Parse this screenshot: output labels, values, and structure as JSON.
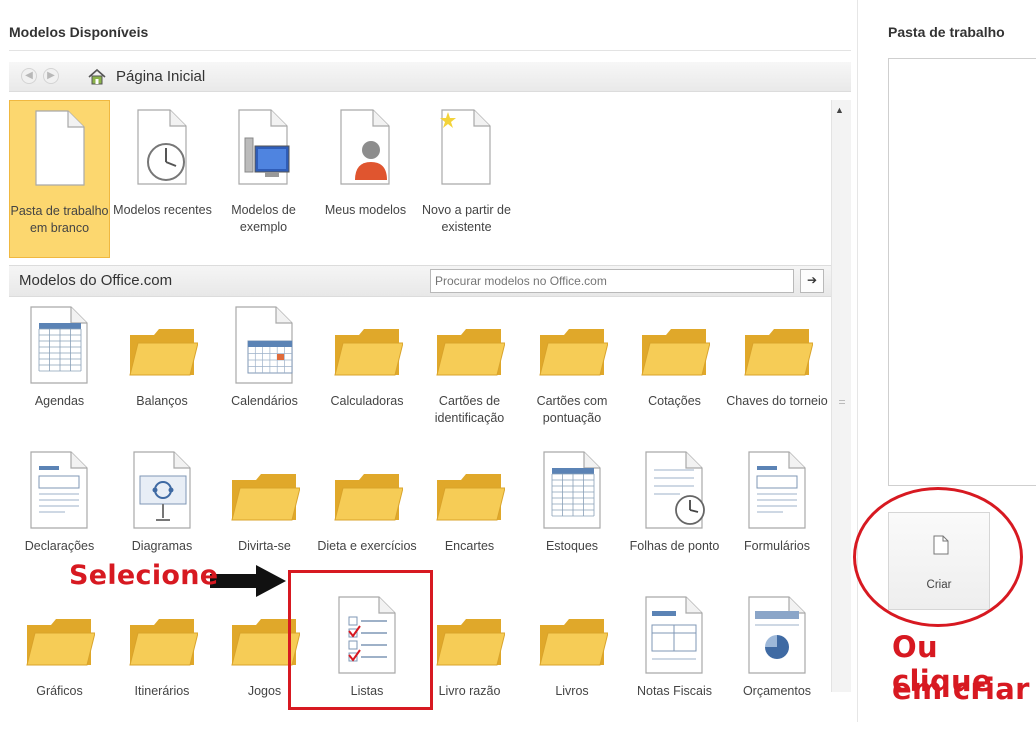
{
  "sections": {
    "available_title": "Modelos Disponíveis",
    "workbook_title": "Pasta de trabalho"
  },
  "nav": {
    "home_label": "Página Inicial"
  },
  "top_tiles": [
    {
      "label": "Pasta de trabalho em branco",
      "icon": "blank-document-icon",
      "selected": true
    },
    {
      "label": "Modelos recentes",
      "icon": "clock-document-icon"
    },
    {
      "label": "Modelos de exemplo",
      "icon": "sample-templates-icon"
    },
    {
      "label": "Meus modelos",
      "icon": "user-templates-icon"
    },
    {
      "label": "Novo a partir de existente",
      "icon": "new-from-existing-icon"
    }
  ],
  "office": {
    "label": "Modelos do Office.com",
    "search_placeholder": "Procurar modelos no Office.com",
    "search_go": "➔"
  },
  "office_rows": [
    [
      {
        "label": "Agendas",
        "icon": "spreadsheet-icon"
      },
      {
        "label": "Balanços",
        "icon": "folder-icon"
      },
      {
        "label": "Calendários",
        "icon": "calendar-icon"
      },
      {
        "label": "Calculadoras",
        "icon": "folder-icon"
      },
      {
        "label": "Cartões de identificação",
        "icon": "folder-icon"
      },
      {
        "label": "Cartões com pontuação",
        "icon": "folder-icon"
      },
      {
        "label": "Cotações",
        "icon": "folder-icon"
      },
      {
        "label": "Chaves do torneio",
        "icon": "folder-icon"
      }
    ],
    [
      {
        "label": "Declarações",
        "icon": "form-document-icon"
      },
      {
        "label": "Diagramas",
        "icon": "diagram-icon"
      },
      {
        "label": "Divirta-se",
        "icon": "folder-icon"
      },
      {
        "label": "Dieta e exercícios",
        "icon": "folder-icon"
      },
      {
        "label": "Encartes",
        "icon": "folder-icon"
      },
      {
        "label": "Estoques",
        "icon": "spreadsheet-icon"
      },
      {
        "label": "Folhas de ponto",
        "icon": "timesheet-icon"
      },
      {
        "label": "Formulários",
        "icon": "form-document-icon"
      }
    ],
    [
      {
        "label": "Gráficos",
        "icon": "folder-icon"
      },
      {
        "label": "Itinerários",
        "icon": "folder-icon"
      },
      {
        "label": "Jogos",
        "icon": "folder-icon"
      },
      {
        "label": "Listas",
        "icon": "checklist-icon"
      },
      {
        "label": "Livro razão",
        "icon": "folder-icon"
      },
      {
        "label": "Livros",
        "icon": "folder-icon"
      },
      {
        "label": "Notas Fiscais",
        "icon": "invoice-icon"
      },
      {
        "label": "Orçamentos",
        "icon": "budget-chart-icon"
      }
    ]
  ],
  "create": {
    "label": "Criar"
  },
  "annotations": {
    "select": "Selecione",
    "click_line1": "Ou clique",
    "click_line2": "em criar",
    "color": "#d71921"
  },
  "colors": {
    "selected_tile": "#fcd76f",
    "folder": "#f2c447"
  }
}
